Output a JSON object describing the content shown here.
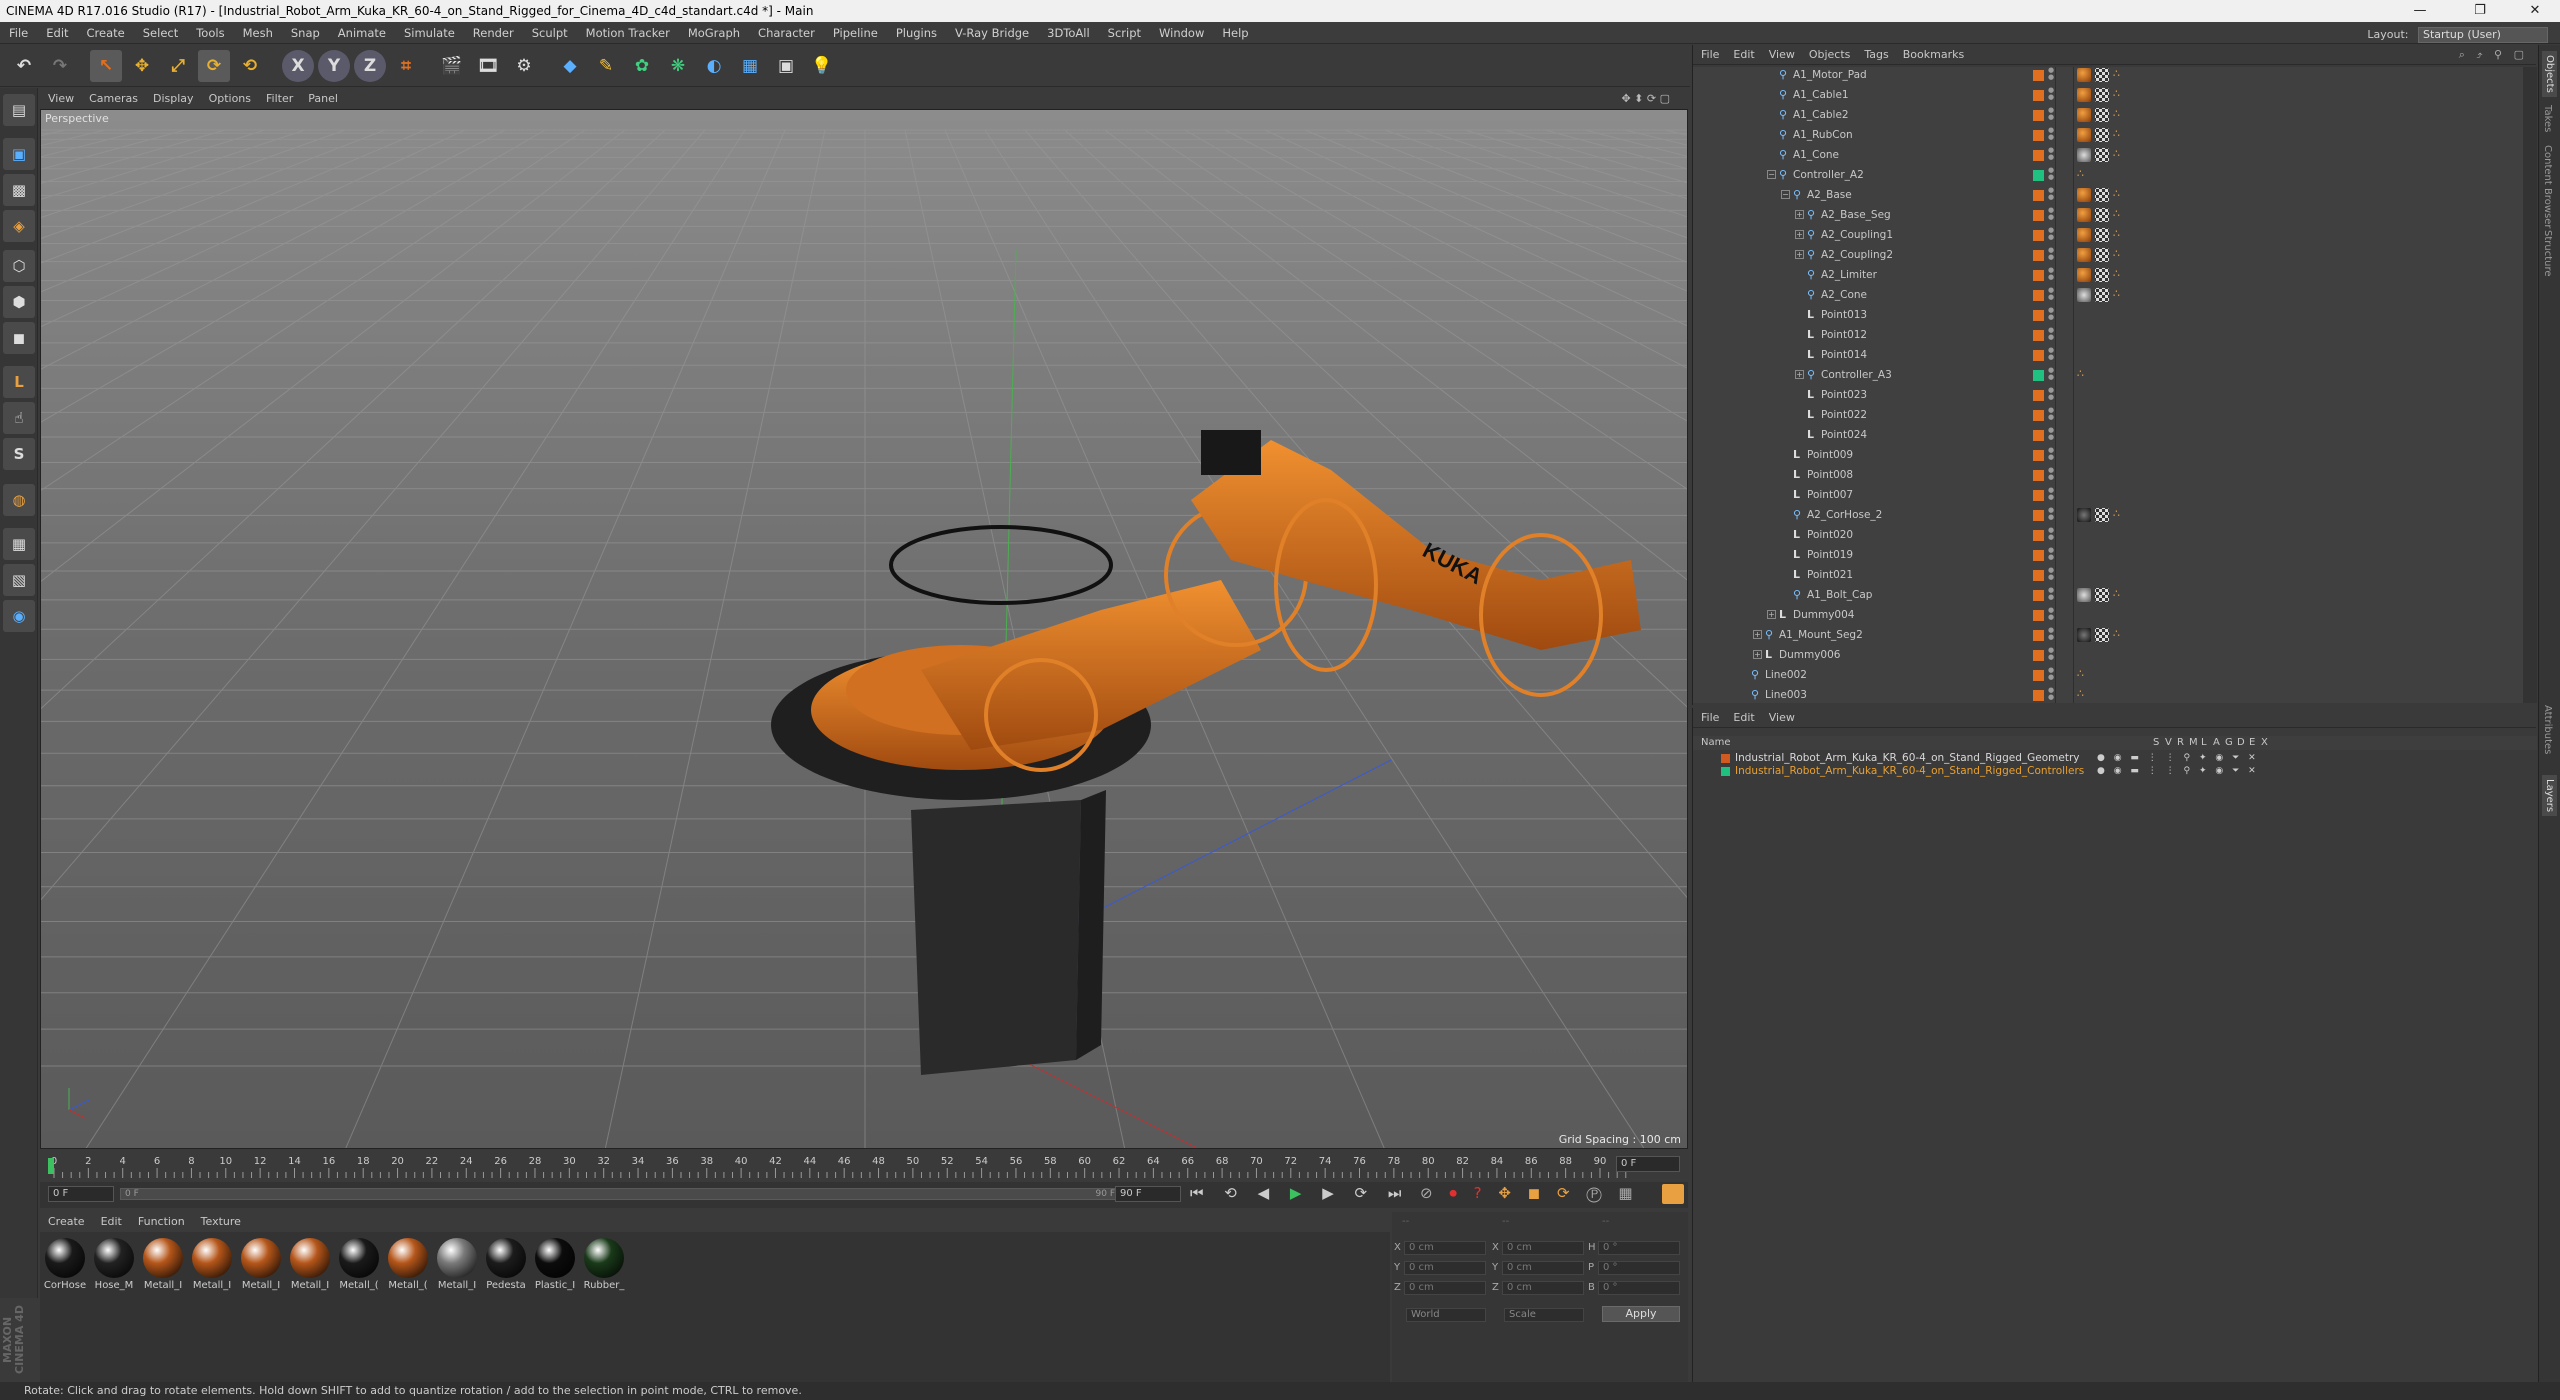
{
  "window": {
    "title": "CINEMA 4D R17.016 Studio (R17) - [Industrial_Robot_Arm_Kuka_KR_60-4_on_Stand_Rigged_for_Cinema_4D_c4d_standart.c4d *] - Main",
    "minimize": "—",
    "maximize": "❐",
    "close": "✕"
  },
  "menu": [
    "File",
    "Edit",
    "Create",
    "Select",
    "Tools",
    "Mesh",
    "Snap",
    "Animate",
    "Simulate",
    "Render",
    "Sculpt",
    "Motion Tracker",
    "MoGraph",
    "Character",
    "Pipeline",
    "Plugins",
    "V-Ray Bridge",
    "3DToAll",
    "Script",
    "Window",
    "Help"
  ],
  "layout": {
    "label": "Layout:",
    "value": "Startup (User)"
  },
  "toolbar": {
    "undo": "↶",
    "redo": "↷",
    "move": "✥",
    "scale": "⤢",
    "rotate": "⟳",
    "x": "X",
    "y": "Y",
    "z": "Z"
  },
  "viewport": {
    "menu": [
      "View",
      "Cameras",
      "Display",
      "Options",
      "Filter",
      "Panel"
    ],
    "label": "Perspective",
    "grid_spacing": "Grid Spacing : 100 cm",
    "robot_logo": "KUKA"
  },
  "timeline": {
    "ticks": [
      "0",
      "2",
      "4",
      "6",
      "8",
      "10",
      "12",
      "14",
      "16",
      "18",
      "20",
      "22",
      "24",
      "26",
      "28",
      "30",
      "32",
      "34",
      "36",
      "38",
      "40",
      "42",
      "44",
      "46",
      "48",
      "50",
      "52",
      "54",
      "56",
      "58",
      "60",
      "62",
      "64",
      "66",
      "68",
      "70",
      "72",
      "74",
      "76",
      "78",
      "80",
      "82",
      "84",
      "86",
      "88",
      "90"
    ],
    "current_frame": "0 F",
    "start": "0 F",
    "range_start": "0 F",
    "range_end": "90 F",
    "end": "90 F"
  },
  "materials": {
    "menu": [
      "Create",
      "Edit",
      "Function",
      "Texture"
    ],
    "items": [
      {
        "name": "CorHose",
        "color": "#1a1a1a"
      },
      {
        "name": "Hose_M",
        "color": "#222222"
      },
      {
        "name": "Metall_I",
        "color": "#b5561a"
      },
      {
        "name": "Metall_I",
        "color": "#b5561a"
      },
      {
        "name": "Metall_I",
        "color": "#b5561a"
      },
      {
        "name": "Metall_I",
        "color": "#b5561a"
      },
      {
        "name": "Metall_(",
        "color": "#1a1a1a"
      },
      {
        "name": "Metall_(",
        "color": "#b5561a"
      },
      {
        "name": "Metall_I",
        "color": "#7a7a7a"
      },
      {
        "name": "Pedesta",
        "color": "#1c1c1c"
      },
      {
        "name": "Plastic_I",
        "color": "#0c0c0c"
      },
      {
        "name": "Rubber_",
        "color": "#1a3a1a"
      }
    ]
  },
  "coords": {
    "header": [
      "--",
      "--",
      "--"
    ],
    "rows": [
      {
        "a": "X",
        "av": "0 cm",
        "b": "X",
        "bv": "0 cm",
        "c": "H",
        "cv": "0 °"
      },
      {
        "a": "Y",
        "av": "0 cm",
        "b": "Y",
        "bv": "0 cm",
        "c": "P",
        "cv": "0 °"
      },
      {
        "a": "Z",
        "av": "0 cm",
        "b": "Z",
        "bv": "0 cm",
        "c": "B",
        "cv": "0 °"
      }
    ],
    "mode": "World",
    "scale": "Scale",
    "apply": "Apply"
  },
  "status": "Rotate: Click and drag to rotate elements. Hold down SHIFT to add to quantize rotation / add to the selection in point mode, CTRL to remove.",
  "maxon": "MAXON CINEMA 4D",
  "object_manager": {
    "menu": [
      "File",
      "Edit",
      "View",
      "Objects",
      "Tags",
      "Bookmarks"
    ],
    "rows": [
      {
        "name": "A1_Motor_Pad",
        "indent": 3,
        "icon": "bone",
        "sw": "#e07020",
        "tags": "mat3"
      },
      {
        "name": "A1_Cable1",
        "indent": 3,
        "icon": "bone",
        "sw": "#e07020",
        "tags": "mat3"
      },
      {
        "name": "A1_Cable2",
        "indent": 3,
        "icon": "bone",
        "sw": "#e07020",
        "tags": "mat3"
      },
      {
        "name": "A1_RubCon",
        "indent": 3,
        "icon": "bone",
        "sw": "#e07020",
        "tags": "mat3"
      },
      {
        "name": "A1_Cone",
        "indent": 3,
        "icon": "bone",
        "sw": "#e07020",
        "tags": "mat3g"
      },
      {
        "name": "Controller_A2",
        "indent": 3,
        "icon": "null",
        "sw": "#20c080",
        "tags": "dot",
        "exp": "−"
      },
      {
        "name": "A2_Base",
        "indent": 4,
        "icon": "bone",
        "sw": "#e07020",
        "tags": "mat3",
        "exp": "−"
      },
      {
        "name": "A2_Base_Seg",
        "indent": 5,
        "icon": "bone",
        "sw": "#e07020",
        "tags": "mat3",
        "exp": "+"
      },
      {
        "name": "A2_Coupling1",
        "indent": 5,
        "icon": "bone",
        "sw": "#e07020",
        "tags": "mat3",
        "exp": "+"
      },
      {
        "name": "A2_Coupling2",
        "indent": 5,
        "icon": "bone",
        "sw": "#e07020",
        "tags": "mat3",
        "exp": "+"
      },
      {
        "name": "A2_Limiter",
        "indent": 5,
        "icon": "bone",
        "sw": "#e07020",
        "tags": "mat3"
      },
      {
        "name": "A2_Cone",
        "indent": 5,
        "icon": "bone",
        "sw": "#e07020",
        "tags": "mat3g"
      },
      {
        "name": "Point013",
        "indent": 5,
        "icon": "pt",
        "sw": "#e07020",
        "tags": ""
      },
      {
        "name": "Point012",
        "indent": 5,
        "icon": "pt",
        "sw": "#e07020",
        "tags": ""
      },
      {
        "name": "Point014",
        "indent": 5,
        "icon": "pt",
        "sw": "#e07020",
        "tags": ""
      },
      {
        "name": "Controller_A3",
        "indent": 5,
        "icon": "null",
        "sw": "#20c080",
        "tags": "dot",
        "exp": "+"
      },
      {
        "name": "Point023",
        "indent": 5,
        "icon": "pt",
        "sw": "#e07020",
        "tags": ""
      },
      {
        "name": "Point022",
        "indent": 5,
        "icon": "pt",
        "sw": "#e07020",
        "tags": ""
      },
      {
        "name": "Point024",
        "indent": 5,
        "icon": "pt",
        "sw": "#e07020",
        "tags": ""
      },
      {
        "name": "Point009",
        "indent": 4,
        "icon": "pt",
        "sw": "#e07020",
        "tags": ""
      },
      {
        "name": "Point008",
        "indent": 4,
        "icon": "pt",
        "sw": "#e07020",
        "tags": ""
      },
      {
        "name": "Point007",
        "indent": 4,
        "icon": "pt",
        "sw": "#e07020",
        "tags": ""
      },
      {
        "name": "A2_CorHose_2",
        "indent": 4,
        "icon": "bone",
        "sw": "#e07020",
        "tags": "mat3b"
      },
      {
        "name": "Point020",
        "indent": 4,
        "icon": "pt",
        "sw": "#e07020",
        "tags": ""
      },
      {
        "name": "Point019",
        "indent": 4,
        "icon": "pt",
        "sw": "#e07020",
        "tags": ""
      },
      {
        "name": "Point021",
        "indent": 4,
        "icon": "pt",
        "sw": "#e07020",
        "tags": ""
      },
      {
        "name": "A1_Bolt_Cap",
        "indent": 4,
        "icon": "bone",
        "sw": "#e07020",
        "tags": "mat3g"
      },
      {
        "name": "Dummy004",
        "indent": 3,
        "icon": "pt",
        "sw": "#e07020",
        "tags": "",
        "exp": "+"
      },
      {
        "name": "A1_Mount_Seg2",
        "indent": 2,
        "icon": "bone",
        "sw": "#e07020",
        "tags": "mat3b",
        "exp": "+"
      },
      {
        "name": "Dummy006",
        "indent": 2,
        "icon": "pt",
        "sw": "#e07020",
        "tags": "",
        "exp": "+"
      },
      {
        "name": "Line002",
        "indent": 1,
        "icon": "bone",
        "sw": "#e07020",
        "tags": "dot"
      },
      {
        "name": "Line003",
        "indent": 1,
        "icon": "bone",
        "sw": "#e07020",
        "tags": "dot"
      }
    ]
  },
  "layer_manager": {
    "menu": [
      "File",
      "Edit",
      "View"
    ],
    "columns": [
      "Name",
      "S",
      "V",
      "R",
      "M",
      "L",
      "A",
      "G",
      "D",
      "E",
      "X"
    ],
    "layers": [
      {
        "name": "Industrial_Robot_Arm_Kuka_KR_60-4_on_Stand_Rigged_Geometry",
        "color": "#d05a20",
        "text_color": "#d8d8d8"
      },
      {
        "name": "Industrial_Robot_Arm_Kuka_KR_60-4_on_Stand_Rigged_Controllers",
        "color": "#20c080",
        "text_color": "#e8a030"
      }
    ]
  },
  "side_tabs": [
    "Objects",
    "Takes",
    "Content Browser",
    "Structure",
    "Attributes",
    "Layers"
  ]
}
